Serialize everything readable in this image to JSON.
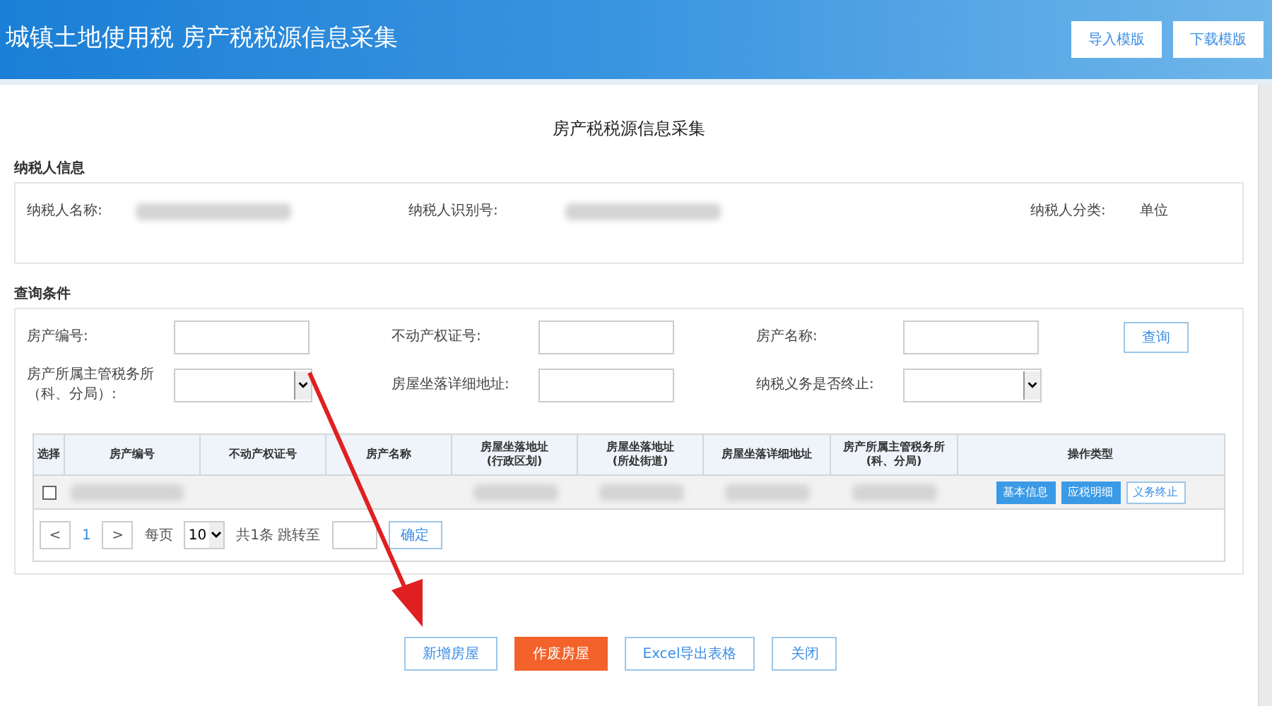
{
  "header": {
    "title": "城镇土地使用税 房产税税源信息采集",
    "buttons": [
      "导入模版",
      "下载模版"
    ]
  },
  "page_title": "房产税税源信息采集",
  "taxpayer": {
    "heading": "纳税人信息",
    "fields": [
      {
        "label": "纳税人名称:",
        "redacted": true
      },
      {
        "label": "纳税人识别号:",
        "redacted": true
      },
      {
        "label": "纳税人分类:",
        "value": "单位"
      }
    ]
  },
  "query": {
    "heading": "查询条件",
    "fields": [
      {
        "label": "房产编号:",
        "kind": "input"
      },
      {
        "label": "不动产权证号:",
        "kind": "input"
      },
      {
        "label": "房产名称:",
        "kind": "input"
      },
      {
        "label": "房产所属主管税务所（科、分局）:",
        "kind": "select"
      },
      {
        "label": "房屋坐落详细地址:",
        "kind": "input"
      },
      {
        "label": "纳税义务是否终止:",
        "kind": "select"
      }
    ],
    "search_button": "查询"
  },
  "table": {
    "columns": [
      "选择",
      "房产编号",
      "不动产权证号",
      "房产名称",
      "房屋坐落地址\n(行政区划)",
      "房屋坐落地址\n(所处街道)",
      "房屋坐落详细地址",
      "房产所属主管税务所\n(科、分局)",
      "操作类型"
    ],
    "rows": [
      {
        "checked": false,
        "actions": [
          {
            "label": "基本信息",
            "kind": "filled"
          },
          {
            "label": "应税明细",
            "kind": "filled"
          },
          {
            "label": "义务终止",
            "kind": "outline"
          }
        ]
      }
    ]
  },
  "pagination": {
    "prev": "<",
    "page": "1",
    "next": ">",
    "per_page_label": "每页",
    "per_page": "10",
    "total": "共1条 跳转至",
    "confirm": "确定"
  },
  "footer_buttons": [
    {
      "label": "新增房屋",
      "kind": "outline"
    },
    {
      "label": "作废房屋",
      "kind": "danger"
    },
    {
      "label": "Excel导出表格",
      "kind": "outline"
    },
    {
      "label": "关闭",
      "kind": "outline"
    }
  ],
  "annotation": {
    "kind": "arrow"
  }
}
